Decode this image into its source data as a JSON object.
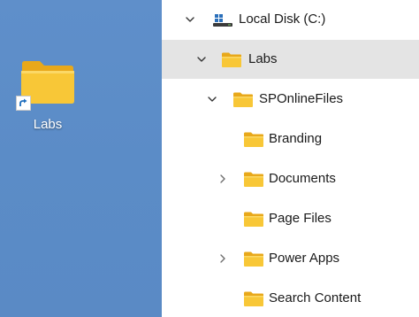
{
  "colors": {
    "desktop_bg": "#5b8cc7",
    "folder_yellow": "#f8c737",
    "folder_back": "#e8a81a",
    "selection_bg": "#e4e4e4"
  },
  "desktop": {
    "shortcut": {
      "label": "Labs",
      "icon": "folder-shortcut-icon"
    }
  },
  "tree": {
    "items": [
      {
        "label": "Local Disk (C:)",
        "icon": "drive-icon",
        "expander": "expanded"
      },
      {
        "label": "Labs",
        "icon": "folder-icon",
        "expander": "expanded",
        "selected": true
      },
      {
        "label": "SPOnlineFiles",
        "icon": "folder-icon",
        "expander": "expanded"
      },
      {
        "label": "Branding",
        "icon": "folder-icon",
        "expander": "none"
      },
      {
        "label": "Documents",
        "icon": "folder-icon",
        "expander": "collapsed"
      },
      {
        "label": "Page Files",
        "icon": "folder-icon",
        "expander": "none"
      },
      {
        "label": "Power Apps",
        "icon": "folder-icon",
        "expander": "collapsed"
      },
      {
        "label": "Search Content",
        "icon": "folder-icon",
        "expander": "none"
      }
    ]
  }
}
